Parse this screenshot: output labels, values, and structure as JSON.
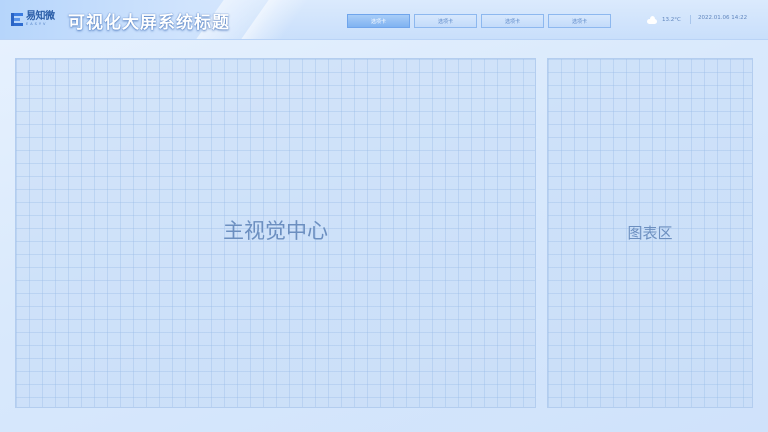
{
  "header": {
    "logo": {
      "name_cn": "易知微",
      "name_en": "EASYV"
    },
    "title": "可视化大屏系统标题",
    "tabs": [
      {
        "label": "选项卡",
        "active": true
      },
      {
        "label": "选项卡",
        "active": false
      },
      {
        "label": "选项卡",
        "active": false
      },
      {
        "label": "选项卡",
        "active": false
      }
    ],
    "weather": {
      "icon": "cloud-icon",
      "temperature": "13.2°C"
    },
    "datetime": "2022.01.06  14:22"
  },
  "main_panel": {
    "label": "主视觉中心"
  },
  "side_panel": {
    "label": "图表区"
  },
  "colors": {
    "accent": "#7fb2f1",
    "title_text": "#ffffff",
    "label_text": "#6c8fc0",
    "panel_border": "#b3cdef"
  }
}
